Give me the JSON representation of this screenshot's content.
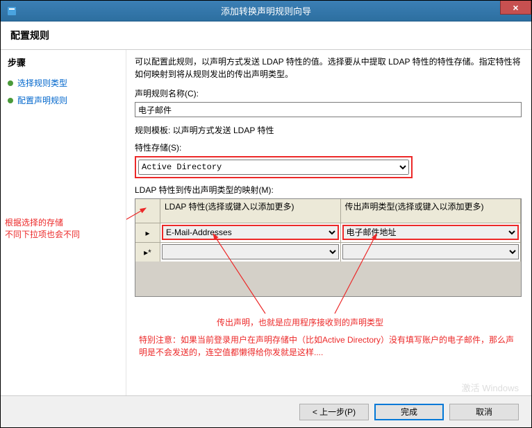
{
  "window": {
    "title": "添加转换声明规则向导",
    "close": "×"
  },
  "header": {
    "title": "配置规则"
  },
  "sidebar": {
    "steps_title": "步骤",
    "items": [
      {
        "label": "选择规则类型"
      },
      {
        "label": "配置声明规则"
      }
    ]
  },
  "main": {
    "description": "可以配置此规则，以声明方式发送 LDAP 特性的值。选择要从中提取 LDAP 特性的特性存储。指定特性将如何映射到将从规则发出的传出声明类型。",
    "rule_name_label": "声明规则名称(C):",
    "rule_name_value": "电子邮件",
    "template_label": "规则模板: 以声明方式发送 LDAP 特性",
    "attr_store_label": "特性存储(S):",
    "attr_store_value": "Active Directory",
    "mapping_label": "LDAP 特性到传出声明类型的映射(M):",
    "grid": {
      "col1": "LDAP 特性(选择或键入以添加更多)",
      "col2": "传出声明类型(选择或键入以添加更多)",
      "rows": [
        {
          "ldap": "E-Mail-Addresses",
          "claim": "电子邮件地址"
        },
        {
          "ldap": "",
          "claim": ""
        }
      ],
      "new_marker": "▸*"
    }
  },
  "annotations": {
    "left_note": "根据选择的存储\n不同下拉项也会不同",
    "mid_note": "传出声明，也就是应用程序接收到的声明类型",
    "bottom_note": "特别注意：如果当前登录用户在声明存储中（比如Active Directory）没有填写账户的电子邮件，那么声明是不会发送的，连空值都懒得给你发就是这样...."
  },
  "buttons": {
    "prev": "< 上一步(P)",
    "finish": "完成",
    "cancel": "取消"
  },
  "watermark": "激活 Windows"
}
